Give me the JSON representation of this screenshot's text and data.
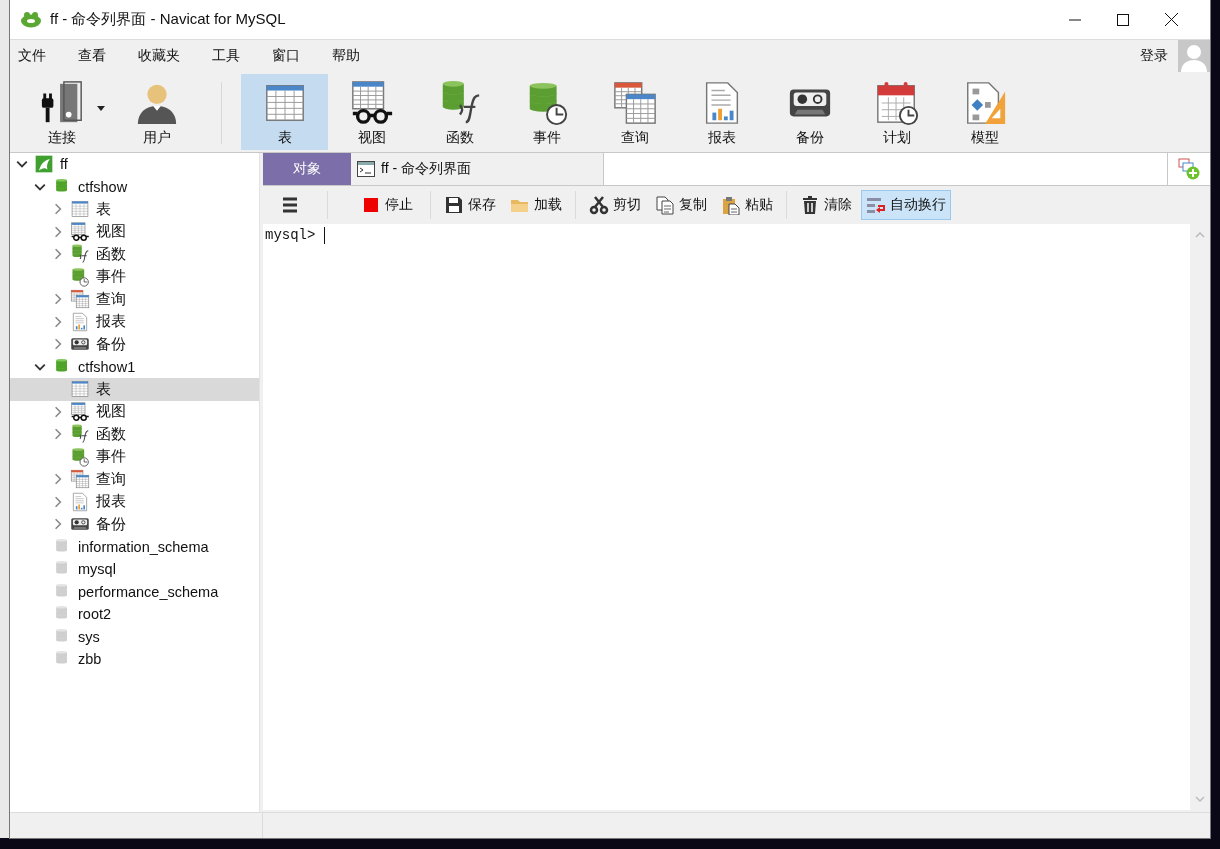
{
  "window": {
    "title": "ff - 命令列界面 - Navicat for MySQL"
  },
  "menu": [
    "文件",
    "查看",
    "收藏夹",
    "工具",
    "窗口",
    "帮助"
  ],
  "account": {
    "label": "登录"
  },
  "toolbar": {
    "connection_tools": [
      {
        "label": "连接",
        "kind": "connection",
        "selected": false,
        "dropdown": true
      },
      {
        "label": "用户",
        "kind": "user",
        "selected": false,
        "dropdown": false
      }
    ],
    "object_tools": [
      {
        "label": "表",
        "kind": "table",
        "selected": true
      },
      {
        "label": "视图",
        "kind": "view",
        "selected": false
      },
      {
        "label": "函数",
        "kind": "function",
        "selected": false
      },
      {
        "label": "事件",
        "kind": "event",
        "selected": false
      },
      {
        "label": "查询",
        "kind": "query",
        "selected": false
      },
      {
        "label": "报表",
        "kind": "report",
        "selected": false
      },
      {
        "label": "备份",
        "kind": "backup",
        "selected": false
      },
      {
        "label": "计划",
        "kind": "schedule",
        "selected": false
      },
      {
        "label": "模型",
        "kind": "model",
        "selected": false
      }
    ]
  },
  "tree": [
    {
      "label": "ff",
      "kind": "connection",
      "expandable": true,
      "expanded": true,
      "selected": false,
      "children": [
        {
          "label": "ctfshow",
          "kind": "database",
          "open": true,
          "expandable": true,
          "expanded": true,
          "selected": false,
          "children": [
            {
              "label": "表",
              "kind": "table",
              "expandable": true,
              "expanded": false,
              "selected": false
            },
            {
              "label": "视图",
              "kind": "view",
              "expandable": true,
              "expanded": false,
              "selected": false
            },
            {
              "label": "函数",
              "kind": "function",
              "expandable": true,
              "expanded": false,
              "selected": false
            },
            {
              "label": "事件",
              "kind": "event",
              "expandable": false,
              "selected": false
            },
            {
              "label": "查询",
              "kind": "query",
              "expandable": true,
              "expanded": false,
              "selected": false
            },
            {
              "label": "报表",
              "kind": "report",
              "expandable": true,
              "expanded": false,
              "selected": false
            },
            {
              "label": "备份",
              "kind": "backup",
              "expandable": true,
              "expanded": false,
              "selected": false
            }
          ]
        },
        {
          "label": "ctfshow1",
          "kind": "database",
          "open": true,
          "expandable": true,
          "expanded": true,
          "selected": false,
          "children": [
            {
              "label": "表",
              "kind": "table",
              "expandable": false,
              "selected": true
            },
            {
              "label": "视图",
              "kind": "view",
              "expandable": true,
              "expanded": false,
              "selected": false
            },
            {
              "label": "函数",
              "kind": "function",
              "expandable": true,
              "expanded": false,
              "selected": false
            },
            {
              "label": "事件",
              "kind": "event",
              "expandable": false,
              "selected": false
            },
            {
              "label": "查询",
              "kind": "query",
              "expandable": true,
              "expanded": false,
              "selected": false
            },
            {
              "label": "报表",
              "kind": "report",
              "expandable": true,
              "expanded": false,
              "selected": false
            },
            {
              "label": "备份",
              "kind": "backup",
              "expandable": true,
              "expanded": false,
              "selected": false
            }
          ]
        },
        {
          "label": "information_schema",
          "kind": "database",
          "open": false,
          "expandable": false,
          "selected": false
        },
        {
          "label": "mysql",
          "kind": "database",
          "open": false,
          "expandable": false,
          "selected": false
        },
        {
          "label": "performance_schema",
          "kind": "database",
          "open": false,
          "expandable": false,
          "selected": false
        },
        {
          "label": "root2",
          "kind": "database",
          "open": false,
          "expandable": false,
          "selected": false
        },
        {
          "label": "sys",
          "kind": "database",
          "open": false,
          "expandable": false,
          "selected": false
        },
        {
          "label": "zbb",
          "kind": "database",
          "open": false,
          "expandable": false,
          "selected": false
        }
      ]
    }
  ],
  "tabs": [
    {
      "label": "对象",
      "kind": "objects",
      "selected": false
    },
    {
      "label": "ff - 命令列界面",
      "kind": "console",
      "selected": true
    }
  ],
  "console_toolbar": [
    {
      "buttons": [
        {
          "kind": "menu",
          "on": false
        }
      ]
    },
    {
      "buttons": [
        {
          "label": "停止",
          "kind": "stop",
          "on": false
        }
      ]
    },
    {
      "buttons": [
        {
          "label": "保存",
          "kind": "save",
          "on": false
        },
        {
          "label": "加载",
          "kind": "load",
          "on": false
        }
      ]
    },
    {
      "buttons": [
        {
          "label": "剪切",
          "kind": "cut",
          "on": false
        },
        {
          "label": "复制",
          "kind": "copy",
          "on": false
        },
        {
          "label": "粘贴",
          "kind": "paste",
          "on": false
        }
      ]
    },
    {
      "buttons": [
        {
          "label": "清除",
          "kind": "clear",
          "on": false
        },
        {
          "label": "自动换行",
          "kind": "wrap",
          "on": true
        }
      ]
    }
  ],
  "editor": {
    "prompt": "mysql>"
  }
}
